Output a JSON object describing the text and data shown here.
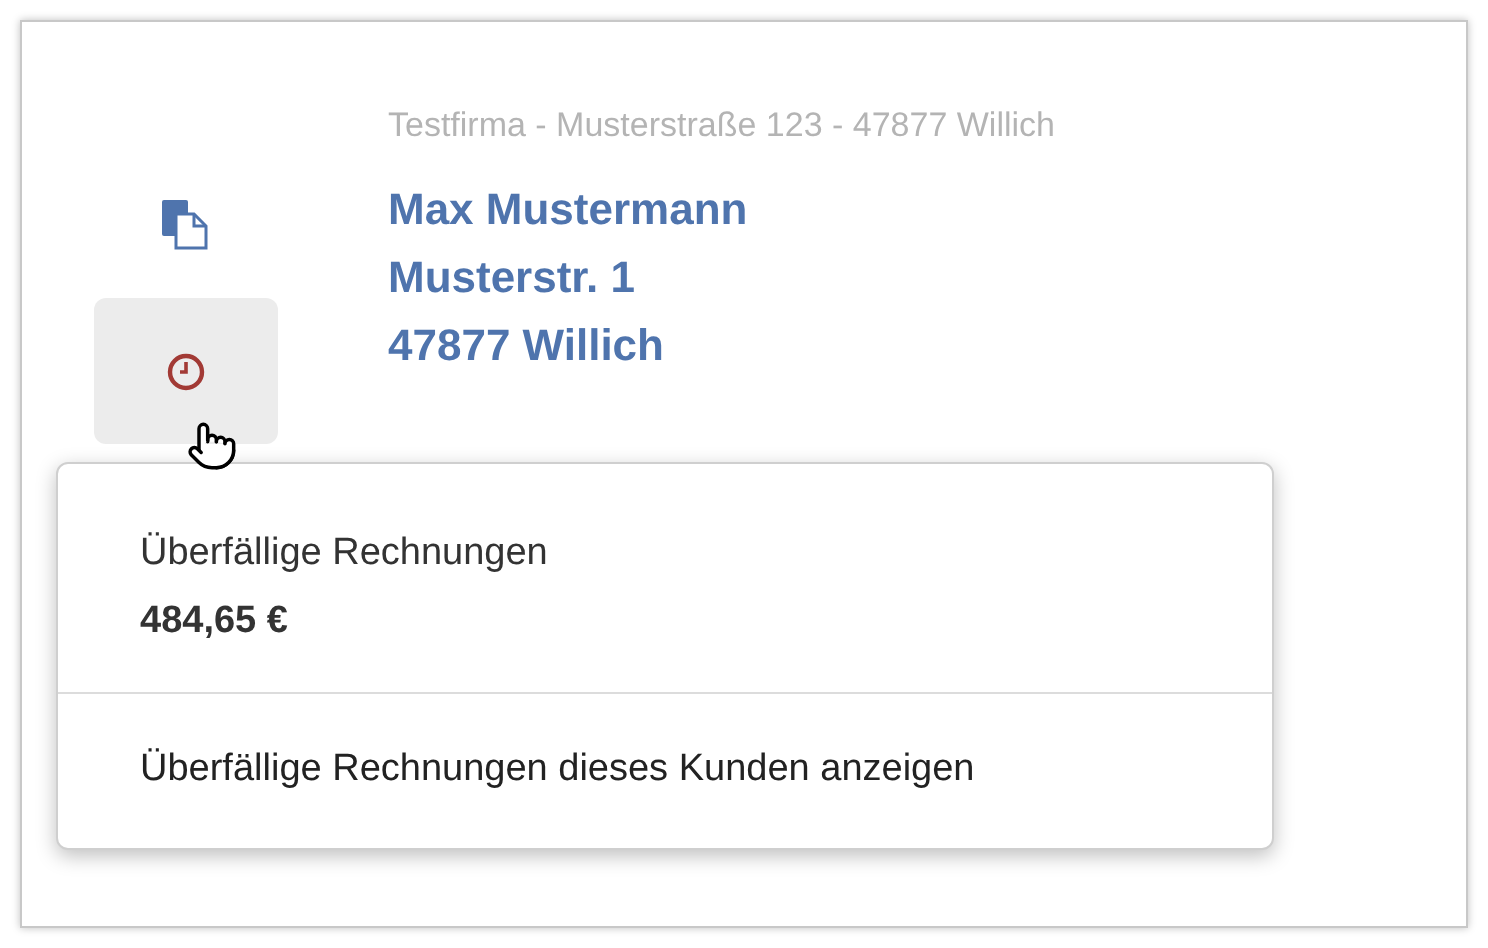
{
  "sender_line": "Testfirma - Musterstraße 123 - 47877 Willich",
  "address_lines": [
    "Max Mustermann",
    "Musterstr. 1",
    "47877 Willich"
  ],
  "popover": {
    "title": "Überfällige Rechnungen",
    "amount": "484,65 €",
    "action": "Überfällige Rechnungen dieses Kunden anzeigen"
  }
}
